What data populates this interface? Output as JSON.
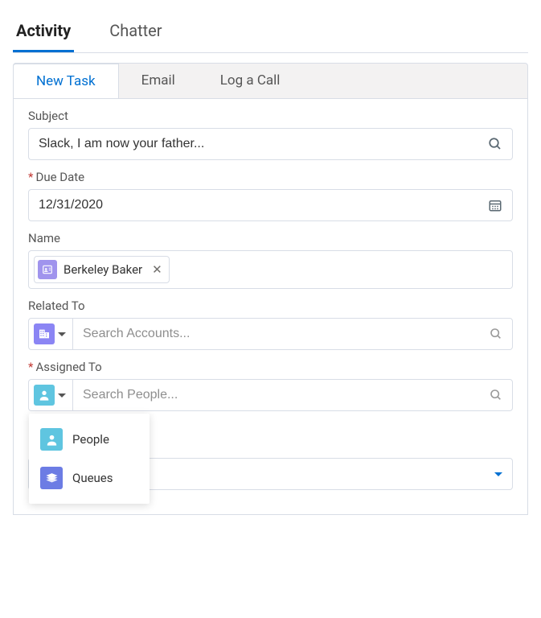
{
  "topTabs": {
    "activity": "Activity",
    "chatter": "Chatter"
  },
  "subTabs": {
    "newTask": "New Task",
    "email": "Email",
    "logCall": "Log a Call"
  },
  "fields": {
    "subject": {
      "label": "Subject",
      "value": "Slack, I am now your father..."
    },
    "dueDate": {
      "label": "Due Date",
      "value": "12/31/2020"
    },
    "name": {
      "label": "Name",
      "chip": "Berkeley Baker"
    },
    "relatedTo": {
      "label": "Related To",
      "placeholder": "Search Accounts..."
    },
    "assignedTo": {
      "label": "Assigned To",
      "placeholder": "Search People..."
    }
  },
  "dropdown": {
    "people": "People",
    "queues": "Queues"
  }
}
